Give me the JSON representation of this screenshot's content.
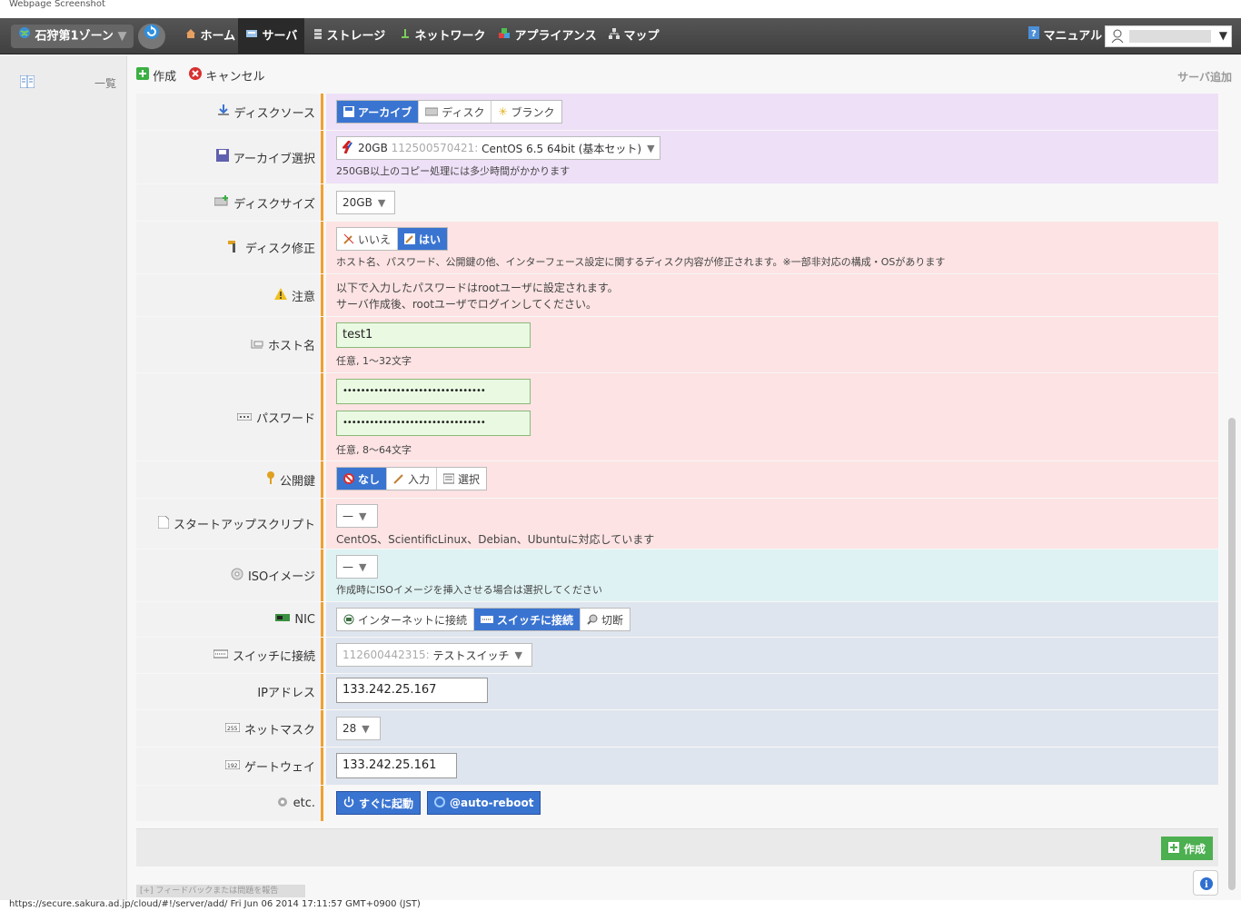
{
  "window_title": "Webpage Screenshot",
  "topbar": {
    "zone": "石狩第1ゾーン",
    "nav": [
      {
        "label": "ホーム",
        "active": false
      },
      {
        "label": "サーバ",
        "active": true
      },
      {
        "label": "ストレージ",
        "active": false
      },
      {
        "label": "ネットワーク",
        "active": false
      },
      {
        "label": "アプライアンス",
        "active": false
      },
      {
        "label": "マップ",
        "active": false
      }
    ],
    "manual": "マニュアル"
  },
  "sidebar": {
    "list_label": "一覧"
  },
  "toolbar": {
    "create": "作成",
    "cancel": "キャンセル",
    "page_title": "サーバ追加"
  },
  "form": {
    "disk_source": {
      "label": "ディスクソース",
      "options": [
        "アーカイブ",
        "ディスク",
        "ブランク"
      ],
      "selected": "アーカイブ"
    },
    "archive": {
      "label": "アーカイブ選択",
      "size": "20GB",
      "id": "112500570421:",
      "name": "CentOS 6.5 64bit (基本セット)",
      "note": "250GB以上のコピー処理には多少時間がかかります"
    },
    "disk_size": {
      "label": "ディスクサイズ",
      "value": "20GB"
    },
    "disk_edit": {
      "label": "ディスク修正",
      "options": [
        "いいえ",
        "はい"
      ],
      "selected": "はい",
      "note": "ホスト名、パスワード、公開鍵の他、インターフェース設定に関するディスク内容が修正されます。※一部非対応の構成・OSがあります"
    },
    "caution": {
      "label": "注意",
      "line1": "以下で入力したパスワードはrootユーザに設定されます。",
      "line2": "サーバ作成後、rootユーザでログインしてください。"
    },
    "hostname": {
      "label": "ホスト名",
      "value": "test1",
      "note": "任意, 1〜32文字"
    },
    "password": {
      "label": "パスワード",
      "value": "••••••••••••••••••••••••••••••••",
      "confirm": "••••••••••••••••••••••••••••••••",
      "note": "任意, 8〜64文字"
    },
    "pubkey": {
      "label": "公開鍵",
      "options": [
        "なし",
        "入力",
        "選択"
      ],
      "selected": "なし"
    },
    "startup": {
      "label": "スタートアップスクリプト",
      "value": "—",
      "note": "CentOS、ScientificLinux、Debian、Ubuntuに対応しています"
    },
    "iso": {
      "label": "ISOイメージ",
      "value": "—",
      "note": "作成時にISOイメージを挿入させる場合は選択してください"
    },
    "nic": {
      "label": "NIC",
      "options": [
        "インターネットに接続",
        "スイッチに接続",
        "切断"
      ],
      "selected": "スイッチに接続"
    },
    "switch": {
      "label": "スイッチに接続",
      "id": "112600442315:",
      "name": "テストスイッチ"
    },
    "ip": {
      "label": "IPアドレス",
      "value": "133.242.25.167"
    },
    "netmask": {
      "label": "ネットマスク",
      "value": "28"
    },
    "gateway": {
      "label": "ゲートウェイ",
      "value": "133.242.25.161"
    },
    "etc": {
      "label": "etc.",
      "boot": "すぐに起動",
      "reboot": "@auto-reboot"
    }
  },
  "footer": {
    "create": "作成",
    "feedback": "[+] フィードバックまたは問題を報告"
  },
  "status_url": "https://secure.sakura.ad.jp/cloud/#!/server/add/ Fri Jun 06 2014 17:11:57 GMT+0900 (JST)",
  "colors": {
    "accent": "#3a74d1",
    "create_green": "#4caf50",
    "label_border": "#f0a030"
  }
}
